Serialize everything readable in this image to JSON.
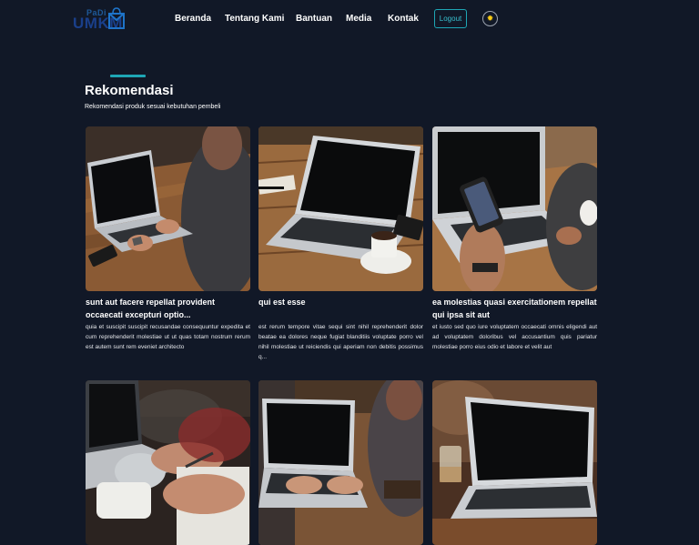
{
  "brand": {
    "logo_top": "PaDi",
    "logo_bottom": "UMKM"
  },
  "nav": {
    "items": [
      "Beranda",
      "Tentang Kami",
      "Bantuan",
      "Media",
      "Kontak"
    ],
    "logout_label": "Logout",
    "theme_icon": "sun-icon"
  },
  "section": {
    "title": "Rekomendasi",
    "subtitle": "Rekomendasi produk sesuai kebutuhan pembeli"
  },
  "products": [
    {
      "title": "sunt aut facere repellat provident occaecati excepturi optio...",
      "description": "quia et suscipit suscipit recusandae consequuntur expedita et cum reprehenderit molestiae ut ut quas totam nostrum rerum est autem sunt rem eveniet architecto",
      "image": "laptop-person-photo"
    },
    {
      "title": "qui est esse",
      "description": "est rerum tempore vitae sequi sint nihil reprehenderit dolor beatae ea dolores neque fugiat blanditiis voluptate porro vel nihil molestiae ut reiciendis qui aperiam non debitis possimus q...",
      "image": "laptop-coffee-photo"
    },
    {
      "title": "ea molestias quasi exercitationem repellat qui ipsa sit aut",
      "description": "et iusto sed quo iure voluptatem occaecati omnis eligendi aut ad voluptatem doloribus vel accusantium quis pariatur molestiae porro eius odio et labore et velit aut",
      "image": "phone-laptop-photo"
    },
    {
      "title": "",
      "description": "",
      "image": "writing-photo"
    },
    {
      "title": "",
      "description": "",
      "image": "typing-laptop-photo"
    },
    {
      "title": "",
      "description": "",
      "image": "laptop-glass-photo"
    }
  ],
  "colors": {
    "background": "#111827",
    "accent": "#1ea6b5",
    "text": "#ffffff"
  }
}
